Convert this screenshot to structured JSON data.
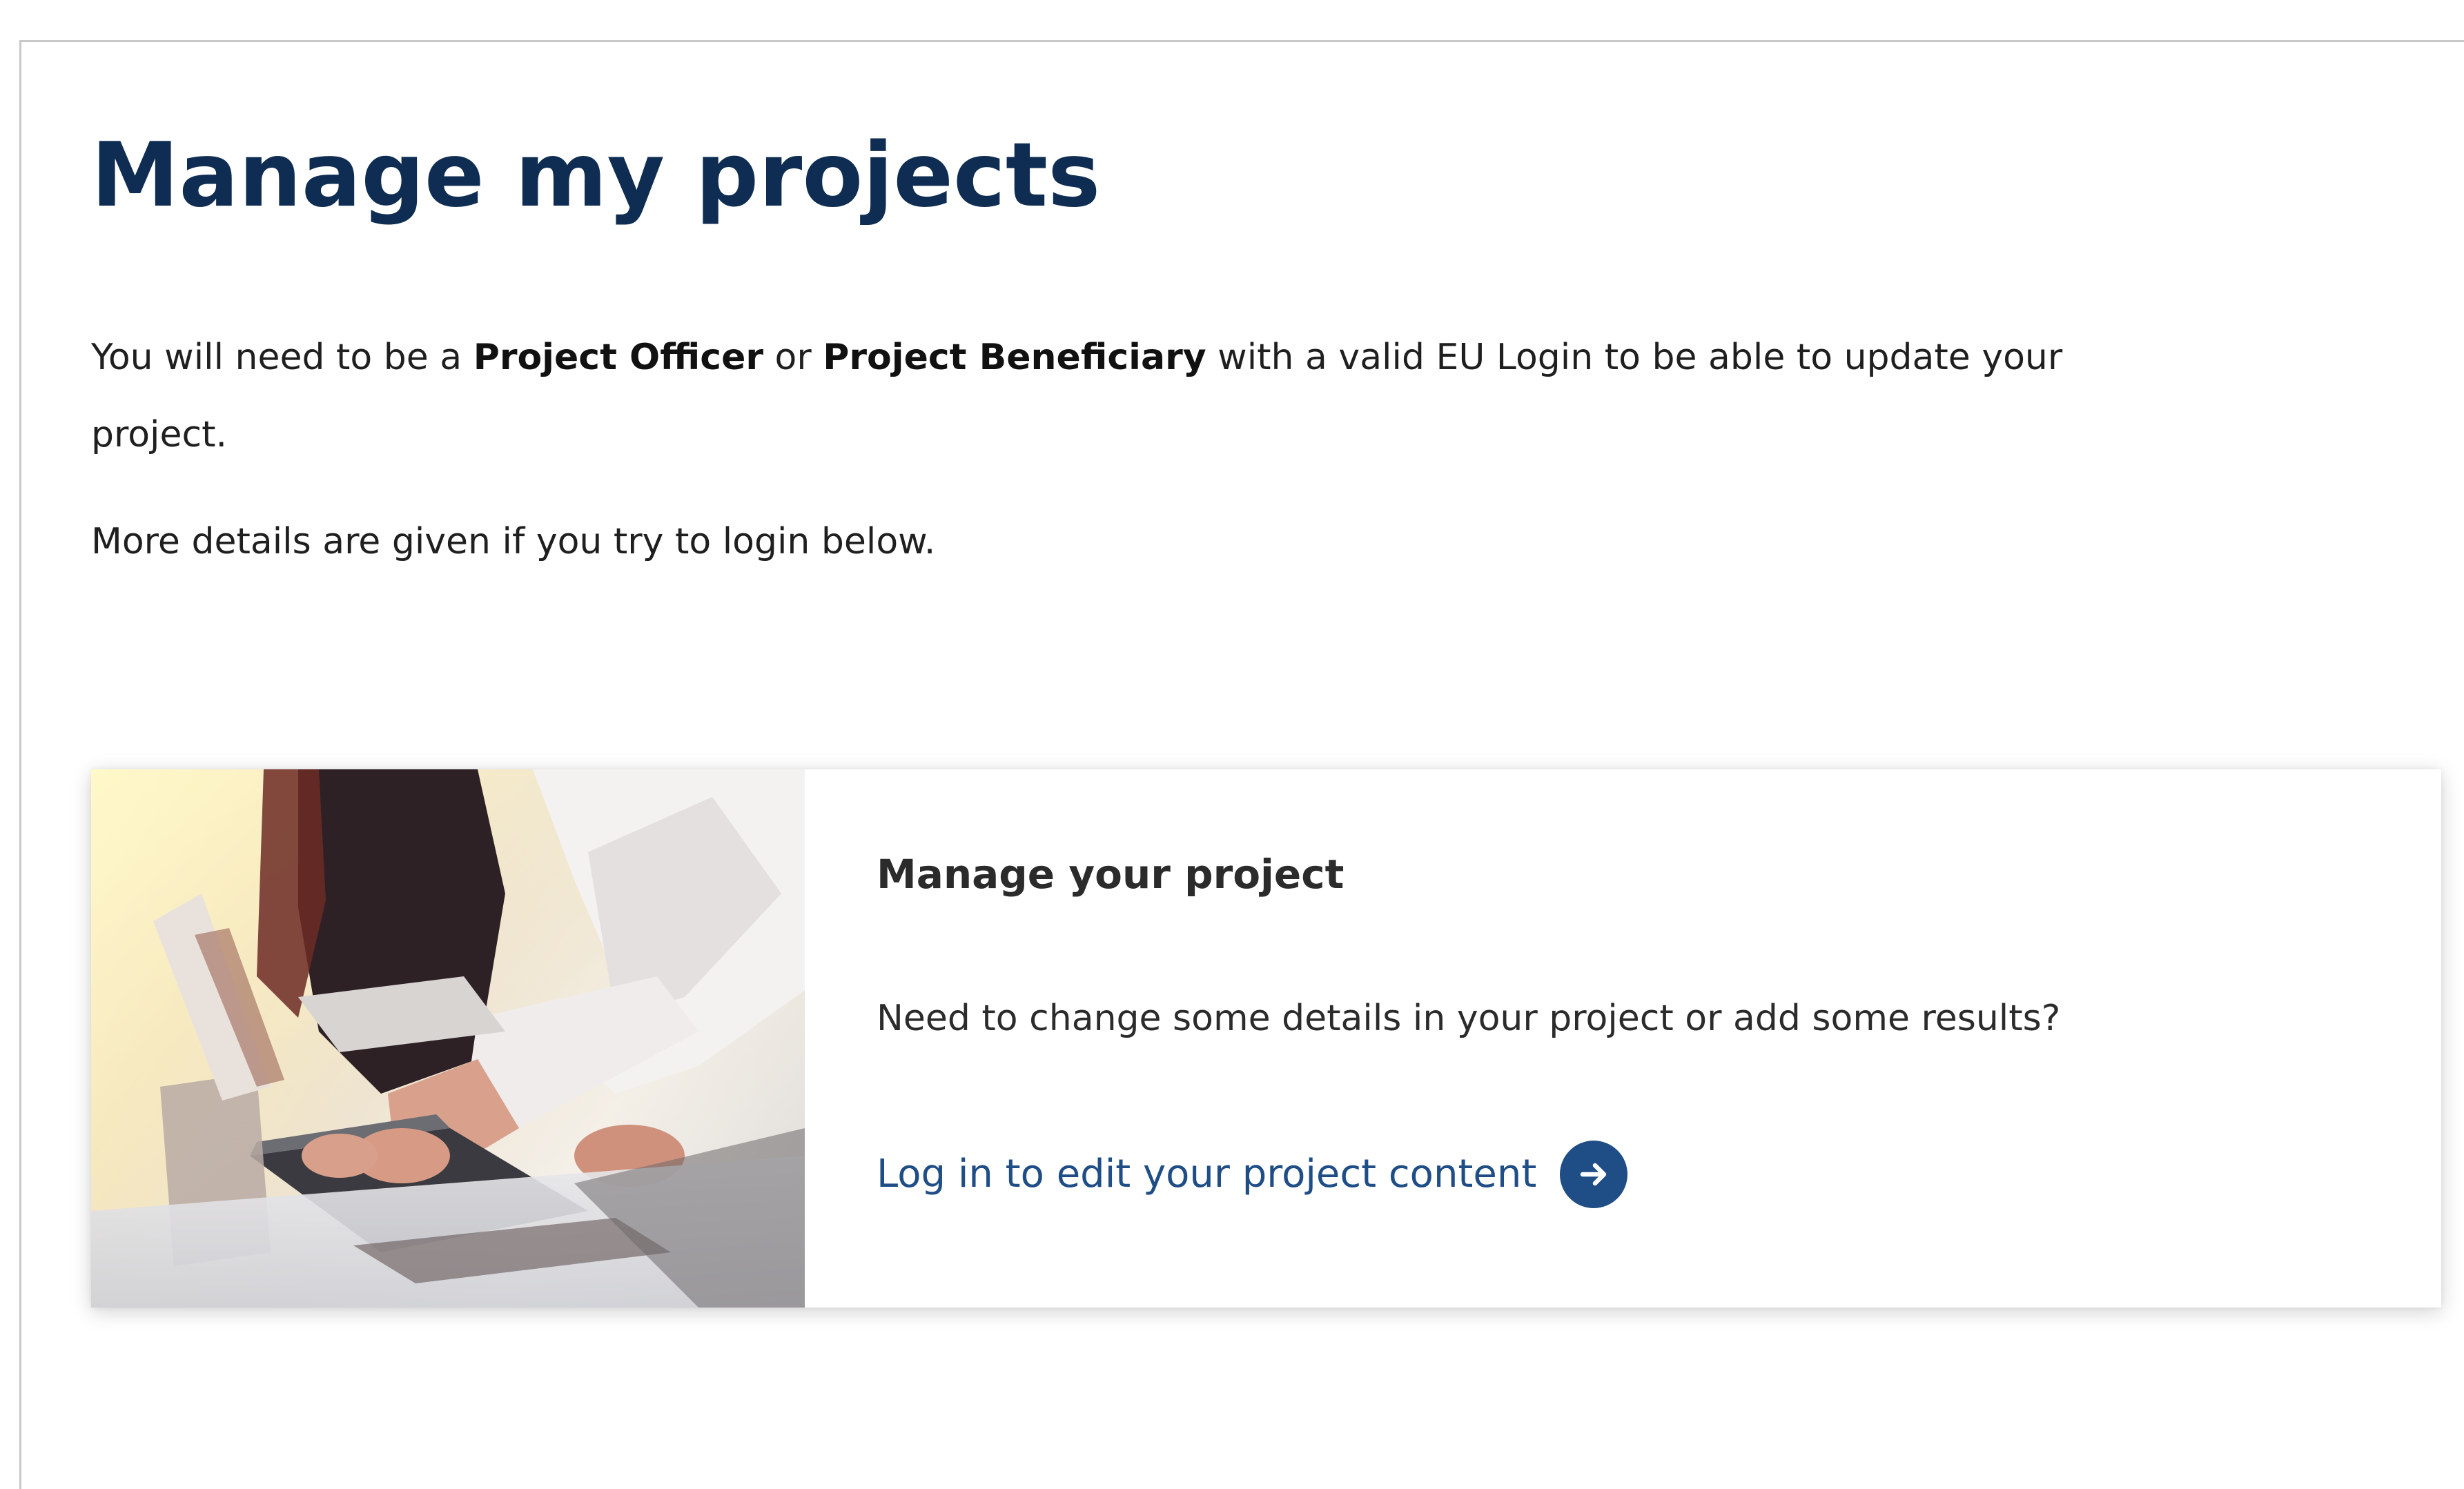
{
  "page": {
    "title": "Manage my projects",
    "intro": {
      "part1": "You will need to be a ",
      "role1": "Project Officer",
      "part2": " or ",
      "role2": "Project Beneficiary",
      "part3": " with a valid EU Login to be able to update your project."
    },
    "more_details": "More details are given if you try to login below."
  },
  "card": {
    "image_icon": "office-team-photo",
    "title": "Manage your project",
    "description": "Need to change some details in your project or add some results?",
    "link_label": "Log in to edit your project content",
    "link_icon": "arrow-right-circle-icon",
    "accent_color": "#1f4d86"
  },
  "colors": {
    "title": "#0f2d52",
    "text": "#1f1f1f"
  }
}
